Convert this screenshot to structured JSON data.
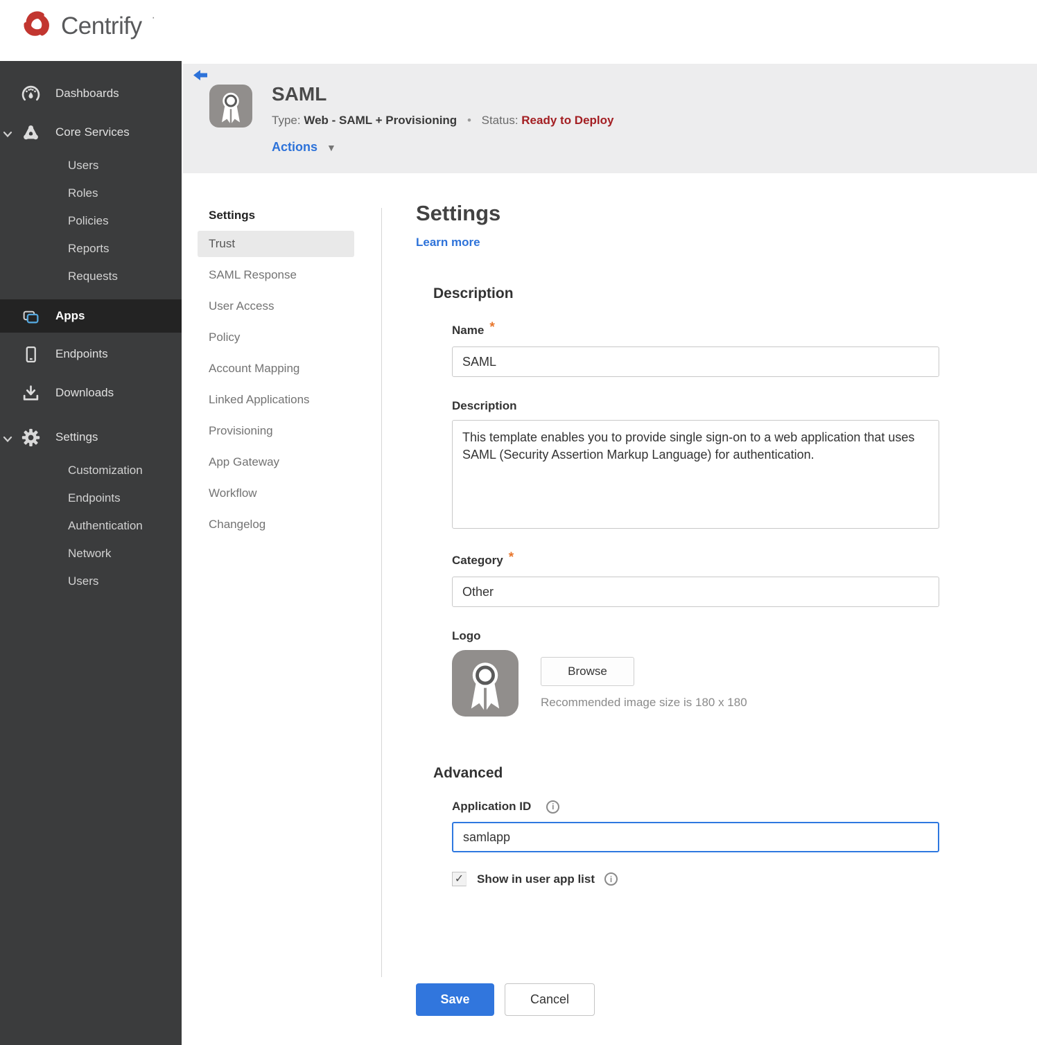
{
  "brand": {
    "name": "Centrify",
    "mark": "·",
    "logo_color": "#c23630"
  },
  "icons": {
    "dropdown": "▼",
    "bullet": "•",
    "check": "✓",
    "info": "i",
    "required": "*"
  },
  "sidebar": {
    "items": [
      {
        "label": "Dashboards"
      },
      {
        "label": "Core Services",
        "expanded": true
      },
      {
        "label": "Users"
      },
      {
        "label": "Roles"
      },
      {
        "label": "Policies"
      },
      {
        "label": "Reports"
      },
      {
        "label": "Requests"
      },
      {
        "label": "Apps",
        "selected": true
      },
      {
        "label": "Endpoints"
      },
      {
        "label": "Downloads"
      },
      {
        "label": "Settings",
        "expanded": true
      },
      {
        "label": "Customization"
      },
      {
        "label": "Endpoints"
      },
      {
        "label": "Authentication"
      },
      {
        "label": "Network"
      },
      {
        "label": "Users"
      }
    ]
  },
  "header": {
    "app_name": "SAML",
    "type_label": "Type:",
    "type_value": "Web - SAML + Provisioning",
    "status_label": "Status:",
    "status_value": "Ready to Deploy",
    "status_color": "#a31e22",
    "actions_label": "Actions"
  },
  "subnav": {
    "heading": "Settings",
    "selected": "Trust",
    "items": [
      "Trust",
      "SAML Response",
      "User Access",
      "Policy",
      "Account Mapping",
      "Linked Applications",
      "Provisioning",
      "App Gateway",
      "Workflow",
      "Changelog"
    ]
  },
  "form": {
    "title": "Settings",
    "learn_more": "Learn more",
    "description_section": "Description",
    "name_label": "Name",
    "name_value": "SAML",
    "description_label": "Description",
    "description_value": "This template enables you to provide single sign-on to a web application that uses SAML (Security Assertion Markup Language) for authentication.",
    "category_label": "Category",
    "category_value": "Other",
    "logo_label": "Logo",
    "browse_label": "Browse",
    "logo_hint": "Recommended image size is 180 x 180",
    "advanced_section": "Advanced",
    "app_id_label": "Application ID",
    "app_id_value": "samlapp",
    "show_in_list_label": "Show in user app list",
    "show_in_list_checked": true,
    "save_label": "Save",
    "cancel_label": "Cancel"
  },
  "colors": {
    "accent_blue": "#3176dd",
    "status_red": "#a31e22",
    "required_orange": "#e8762c",
    "sidebar_bg": "#3b3c3d",
    "sidebar_selected_bg": "#232323",
    "header_band_bg": "#ededee"
  }
}
